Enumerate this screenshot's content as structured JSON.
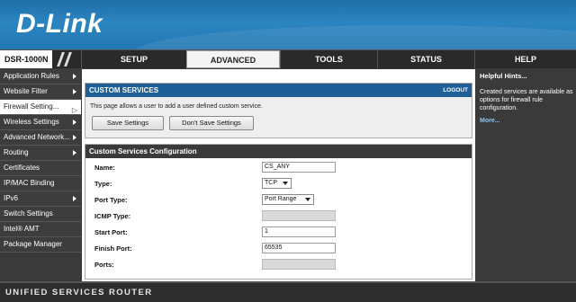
{
  "header": {
    "logo_text": "D-Link"
  },
  "topnav": {
    "model": "DSR-1000N",
    "tabs": [
      {
        "label": "SETUP"
      },
      {
        "label": "ADVANCED",
        "active": true
      },
      {
        "label": "TOOLS"
      },
      {
        "label": "STATUS"
      },
      {
        "label": "HELP"
      }
    ]
  },
  "sidebar": {
    "items": [
      {
        "label": "Application Rules",
        "submenu": true
      },
      {
        "label": "Website Filter",
        "submenu": true
      },
      {
        "label": "Firewall Setting...",
        "submenu": true,
        "active": true
      },
      {
        "label": "Wireless Settings",
        "submenu": true
      },
      {
        "label": "Advanced Network...",
        "submenu": true
      },
      {
        "label": "Routing",
        "submenu": true
      },
      {
        "label": "Certificates",
        "submenu": false
      },
      {
        "label": "IP/MAC Binding",
        "submenu": false
      },
      {
        "label": "IPv6",
        "submenu": true
      },
      {
        "label": "Switch Settings",
        "submenu": false
      },
      {
        "label": "Intel® AMT",
        "submenu": false
      },
      {
        "label": "Package Manager",
        "submenu": false
      }
    ]
  },
  "custom_services": {
    "title": "CUSTOM SERVICES",
    "logout": "LOGOUT",
    "description": "This page allows a user to add a user defined custom service.",
    "save_label": "Save Settings",
    "dont_save_label": "Don't Save Settings"
  },
  "config": {
    "title": "Custom Services Configuration",
    "fields": {
      "name": {
        "label": "Name:",
        "value": "CS_ANY"
      },
      "type": {
        "label": "Type:",
        "value": "TCP"
      },
      "port_type": {
        "label": "Port Type:",
        "value": "Port Range"
      },
      "icmp_type": {
        "label": "ICMP Type:",
        "value": ""
      },
      "start_port": {
        "label": "Start Port:",
        "value": "1"
      },
      "finish_port": {
        "label": "Finish Port:",
        "value": "65535"
      },
      "ports": {
        "label": "Ports:",
        "value": ""
      }
    }
  },
  "help": {
    "title": "Helpful Hints...",
    "body": "Created services are available as options for firewall rule configuration.",
    "more": "More..."
  },
  "footer": {
    "text": "UNIFIED SERVICES ROUTER"
  },
  "colors": {
    "brand_blue": "#2478b4",
    "panel_head_blue": "#1f5f98",
    "dark_gray": "#3a3a3a",
    "link_blue": "#8fc3ef"
  }
}
